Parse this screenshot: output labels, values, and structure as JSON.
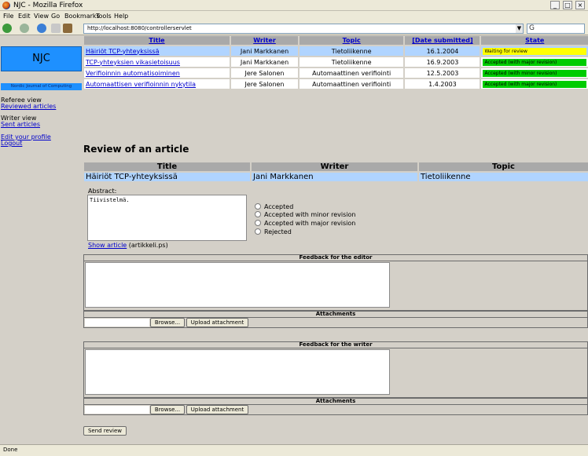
{
  "window": {
    "title": "NJC - Mozilla Firefox",
    "min": "_",
    "max": "□",
    "close": "×"
  },
  "menu": [
    "File",
    "Edit",
    "View",
    "Go",
    "Bookmarks",
    "Tools",
    "Help"
  ],
  "nav": {
    "url": "http://localhost:8080/controllerservlet",
    "search_glyph": "G"
  },
  "logo": {
    "text": "NJC",
    "subtitle": "Nordic Journal of Computing"
  },
  "sidebar": {
    "referee_heading": "Referee view",
    "reviewed_link": "Reviewed articles",
    "writer_heading": "Writer view",
    "sent_link": "Sent articles",
    "edit_profile_link": "Edit your profile",
    "logout_link": "Logout"
  },
  "articles": {
    "headers": {
      "title": "Title",
      "writer": "Writer",
      "topic": "Topic",
      "date": "[Date submitted]",
      "state": "State"
    },
    "rows": [
      {
        "title": "Häiriöt TCP-yhteyksissä",
        "writer": "Jani Markkanen",
        "topic": "Tietoliikenne",
        "date": "16.1.2004",
        "state": "Waiting for review"
      },
      {
        "title": "TCP-yhteyksien vikasietoisuus",
        "writer": "Jani Markkanen",
        "topic": "Tietoliikenne",
        "date": "16.9.2003",
        "state": "Accepted (with major revision)"
      },
      {
        "title": "Verifioinnin automatisoiminen",
        "writer": "Jere Salonen",
        "topic": "Automaattinen verifiointi",
        "date": "12.5.2003",
        "state": "Accepted (with minor revision)"
      },
      {
        "title": "Automaattisen verifioinnin nykytila",
        "writer": "Jere Salonen",
        "topic": "Automaattinen verifiointi",
        "date": "1.4.2003",
        "state": "Accepted (with major revision)"
      }
    ]
  },
  "review": {
    "heading": "Review of an article",
    "headers": {
      "title": "Title",
      "writer": "Writer",
      "topic": "Topic"
    },
    "article": {
      "title": "Häiriöt TCP-yhteyksissä",
      "writer": "Jani Markkanen",
      "topic": "Tietoliikenne"
    },
    "abstract_label": "Abstract:",
    "abstract_text": "Tiivistelmä.",
    "options": [
      "Accepted",
      "Accepted with minor revision",
      "Accepted with major revision",
      "Rejected"
    ],
    "show_article_link": "Show article",
    "article_file": "(artikkeli.ps)",
    "feedback_editor_label": "Feedback for the editor",
    "feedback_writer_label": "Feedback for the writer",
    "attachments_label": "Attachments",
    "browse_label": "Browse...",
    "upload_label": "Upload attachment",
    "send_label": "Send review"
  },
  "status": "Done",
  "colors": {
    "highlight_row": "#b0d4ff",
    "waiting": "#ffff00",
    "accepted": "#00cc00",
    "logo": "#1e90ff"
  }
}
